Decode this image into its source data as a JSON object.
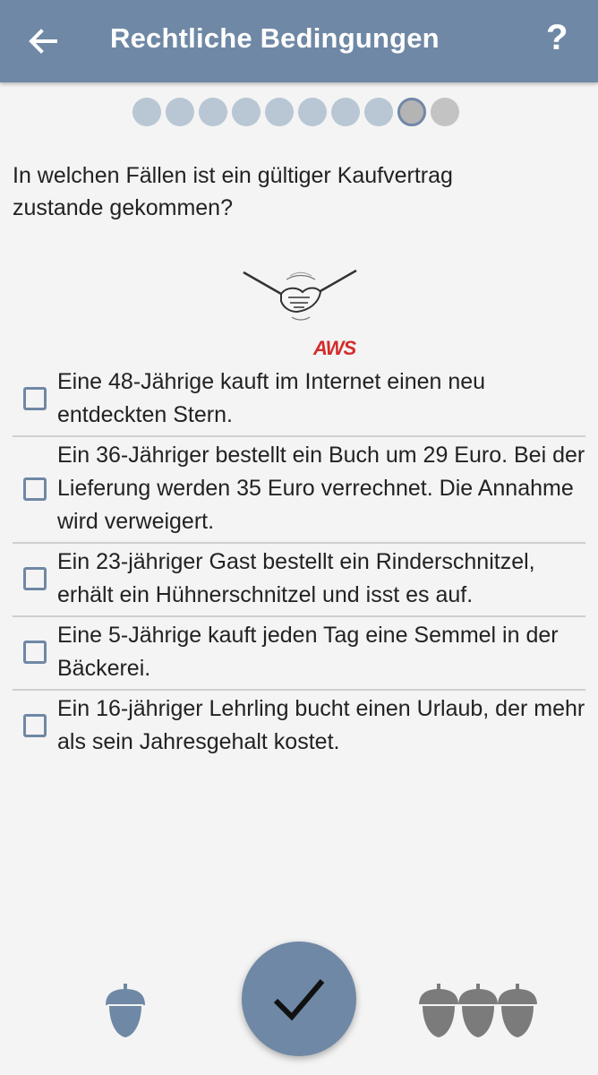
{
  "header": {
    "title": "Rechtliche Bedingungen",
    "help_label": "?",
    "back_icon": "arrow-left-icon"
  },
  "progress": {
    "total": 10,
    "current": 9,
    "completed_color": "#b9c6d4",
    "accent_color": "#6f88a5"
  },
  "question": {
    "text": "In welchen Fällen ist ein gültiger Kaufvertrag zustande gekommen?"
  },
  "illustration": {
    "icon": "handshake-icon",
    "logo_text": "AWS"
  },
  "options": [
    {
      "label": "Eine 48-Jährige kauft im Internet einen neu entdeckten Stern.",
      "checked": false
    },
    {
      "label": "Ein 36-Jähriger bestellt ein Buch um 29 Euro. Bei  der Lieferung werden 35 Euro verrechnet. Die Annahme wird verweigert.",
      "checked": false
    },
    {
      "label": "Ein 23-jähriger Gast bestellt ein Rinderschnitzel, erhält ein Hühnerschnitzel und isst es auf.",
      "checked": false
    },
    {
      "label": "Eine 5-Jährige kauft jeden Tag eine Semmel in der Bäckerei.",
      "checked": false
    },
    {
      "label": "Ein 16-jähriger Lehrling bucht einen Urlaub, der mehr als sein Jahresgehalt kostet.",
      "checked": false
    }
  ],
  "footer": {
    "submit_icon": "checkmark-icon",
    "left_icon": "acorn-icon",
    "right_icon": "acorns-icon",
    "left_count": 1,
    "right_count": 3
  }
}
